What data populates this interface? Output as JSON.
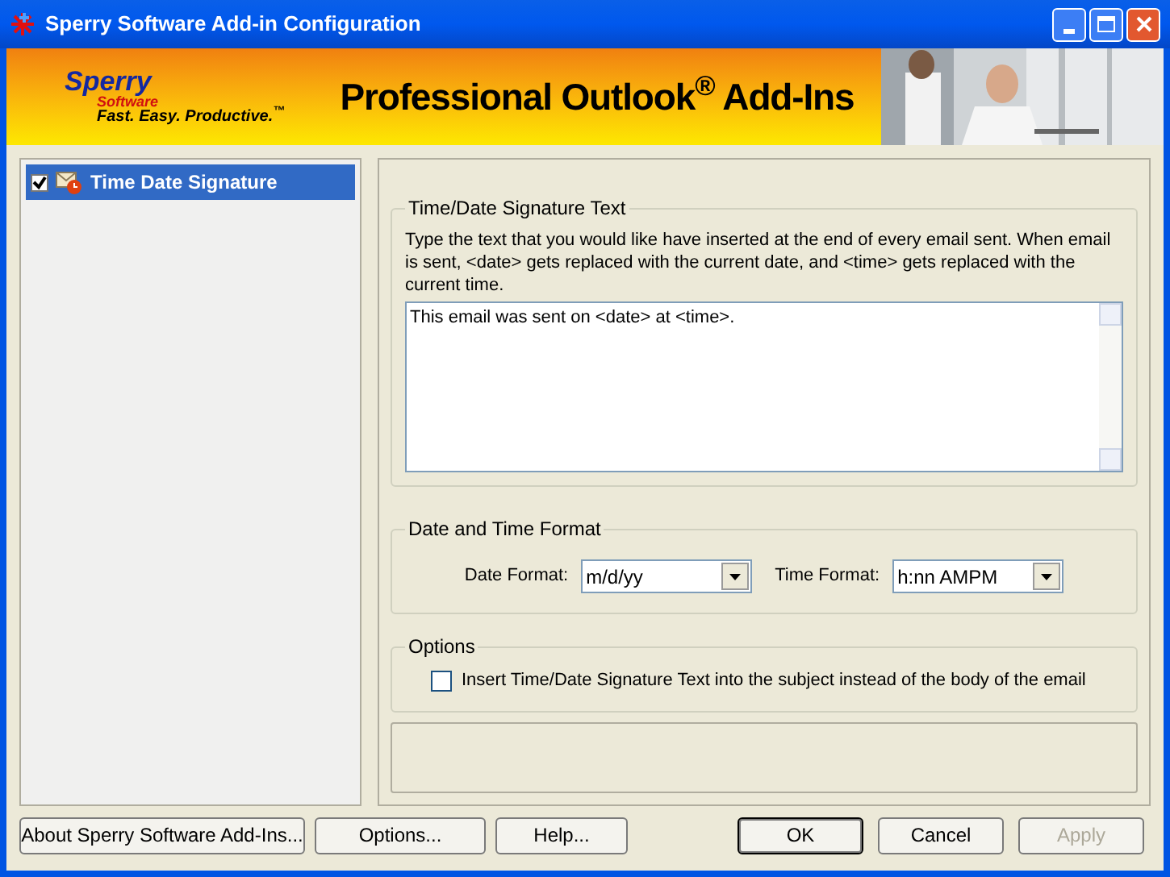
{
  "window": {
    "title": "Sperry Software Add-in Configuration"
  },
  "banner": {
    "logo_name": "Sperry",
    "logo_sub": "Software",
    "tagline": "Fast. Easy. Productive.$^{™}$",
    "heading": "Professional Outlook$^{®}$ Add-Ins"
  },
  "sidebar": {
    "items": [
      {
        "label": "Time Date Signature",
        "checked": true,
        "selected": true
      }
    ]
  },
  "signature_group": {
    "title": "Time/Date Signature Text",
    "description": "Type the text that you would like have inserted at the end of every email sent.  When email is sent, <date> gets replaced with the current date, and <time> gets replaced with the current time.",
    "value": "This email was sent on <date> at <time>."
  },
  "format_group": {
    "title": "Date and Time Format",
    "date_label": "Date Format:",
    "date_value": "m/d/yy",
    "time_label": "Time Format:",
    "time_value": "h:nn AMPM"
  },
  "options_group": {
    "title": "Options",
    "option": {
      "label": "Insert Time/Date Signature Text into the subject instead of the body of the email",
      "checked": false
    }
  },
  "left_buttons": [
    {
      "label": "About Sperry Software Add-Ins...",
      "disabled": false,
      "default": false
    },
    {
      "label": "Options...",
      "disabled": false,
      "default": false
    },
    {
      "label": "Help...",
      "disabled": false,
      "default": false
    }
  ],
  "right_buttons": [
    {
      "label": "OK",
      "disabled": false,
      "default": true
    },
    {
      "label": "Cancel",
      "disabled": false,
      "default": false
    },
    {
      "label": "Apply",
      "disabled": true,
      "default": false
    }
  ]
}
